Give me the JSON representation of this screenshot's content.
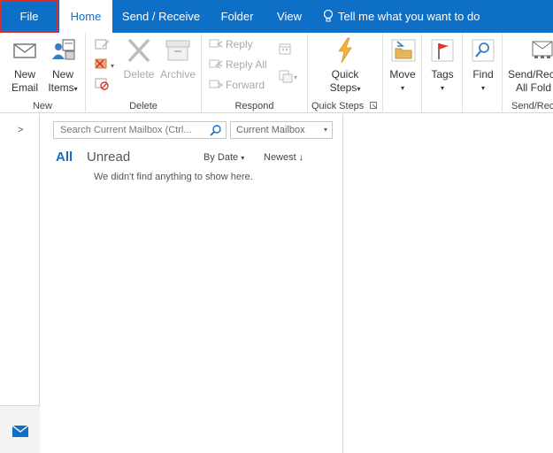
{
  "tabs": {
    "file": "File",
    "home": "Home",
    "send_receive": "Send / Receive",
    "folder": "Folder",
    "view": "View"
  },
  "tell_me": "Tell me what you want to do",
  "ribbon": {
    "new": {
      "new_email_line1": "New",
      "new_email_line2": "Email",
      "new_items_line1": "New",
      "new_items_line2": "Items",
      "label": "New"
    },
    "delete": {
      "delete_label": "Delete",
      "archive_label": "Archive",
      "label": "Delete"
    },
    "respond": {
      "reply": "Reply",
      "reply_all": "Reply All",
      "forward": "Forward",
      "label": "Respond"
    },
    "quick_steps": {
      "line1": "Quick",
      "line2": "Steps",
      "label": "Quick Steps"
    },
    "move": "Move",
    "tags": "Tags",
    "find": "Find",
    "send_receive": {
      "line1": "Send/Rec",
      "line2": "All Fold",
      "label": "Send/Rec"
    }
  },
  "message_list": {
    "search_placeholder": "Search Current Mailbox (Ctrl...",
    "scope": "Current Mailbox",
    "filter_all": "All",
    "filter_unread": "Unread",
    "sort_by": "By Date",
    "order": "Newest",
    "empty_message": "We didn't find anything to show here."
  },
  "colors": {
    "accent": "#0e6fc7",
    "highlight_border": "#e02a2a"
  }
}
